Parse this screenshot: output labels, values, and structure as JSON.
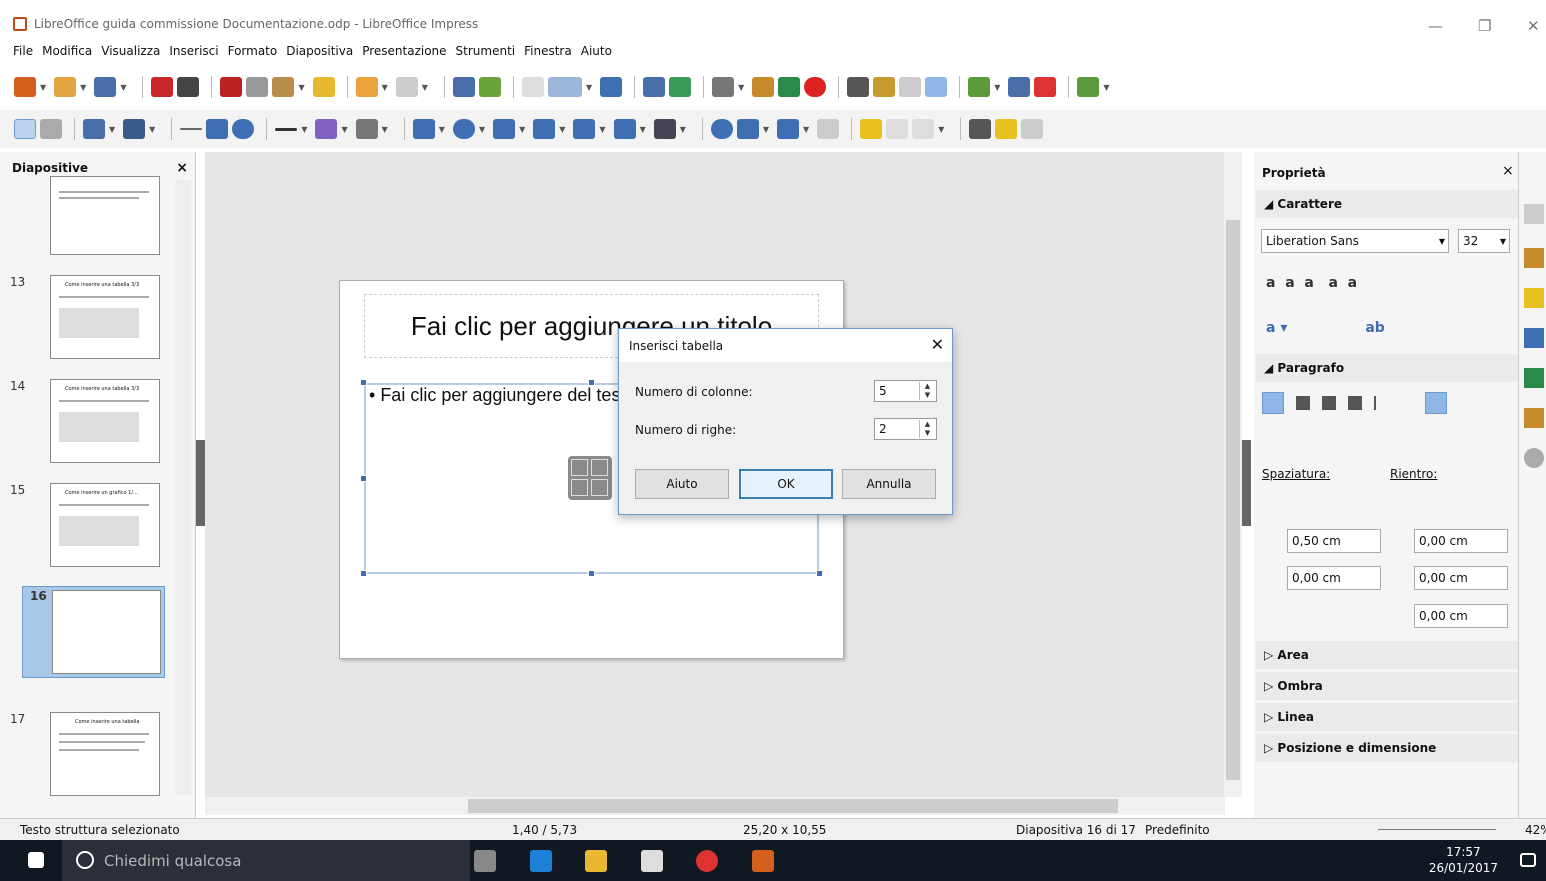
{
  "window": {
    "title": "LibreOffice guida commissione Documentazione.odp - LibreOffice Impress"
  },
  "menu": [
    "File",
    "Modifica",
    "Visualizza",
    "Inserisci",
    "Formato",
    "Diapositiva",
    "Presentazione",
    "Strumenti",
    "Finestra",
    "Aiuto"
  ],
  "slides_pane": {
    "title": "Diapositive",
    "items": [
      {
        "num": "13",
        "title": "Come inserire una tabella 3/3"
      },
      {
        "num": "14",
        "title": "Come inserire una tabella 3/3"
      },
      {
        "num": "15",
        "title": "Come inserire un grafico 1/..."
      },
      {
        "num": "16",
        "title": ""
      },
      {
        "num": "17",
        "title": "Come inserire una tabella"
      }
    ]
  },
  "slide": {
    "title_placeholder": "Fai clic per aggiungere un titolo",
    "content_placeholder": "Fai clic per aggiungere del testo"
  },
  "dialog": {
    "title": "Inserisci tabella",
    "columns_label": "Numero di colonne:",
    "columns_value": "5",
    "rows_label": "Numero di righe:",
    "rows_value": "2",
    "help": "Aiuto",
    "ok": "OK",
    "cancel": "Annulla"
  },
  "sidebar": {
    "title": "Proprietà",
    "character": "Carattere",
    "font": "Liberation Sans",
    "size": "32",
    "paragraph": "Paragrafo",
    "spacing": "Spaziatura:",
    "indent": "Rientro:",
    "above": "0,50 cm",
    "below": "0,00 cm",
    "indent_before": "0,00 cm",
    "indent_after": "0,00 cm",
    "first_line": "0,00 cm",
    "area": "Area",
    "shadow": "Ombra",
    "line": "Linea",
    "position": "Posizione e dimensione"
  },
  "status": {
    "selection": "Testo struttura selezionato",
    "position": "1,40 / 5,73",
    "size": "25,20 x 10,55",
    "slide": "Diapositiva 16 di 17",
    "master": "Predefinito",
    "zoom": "42%"
  },
  "taskbar": {
    "search": "Chiedimi qualcosa",
    "time": "17:57",
    "date": "26/01/2017"
  },
  "colors": {
    "accent": "#3e6fb3",
    "dialog_border": "#6b9bd1",
    "taskbar": "#101822"
  }
}
